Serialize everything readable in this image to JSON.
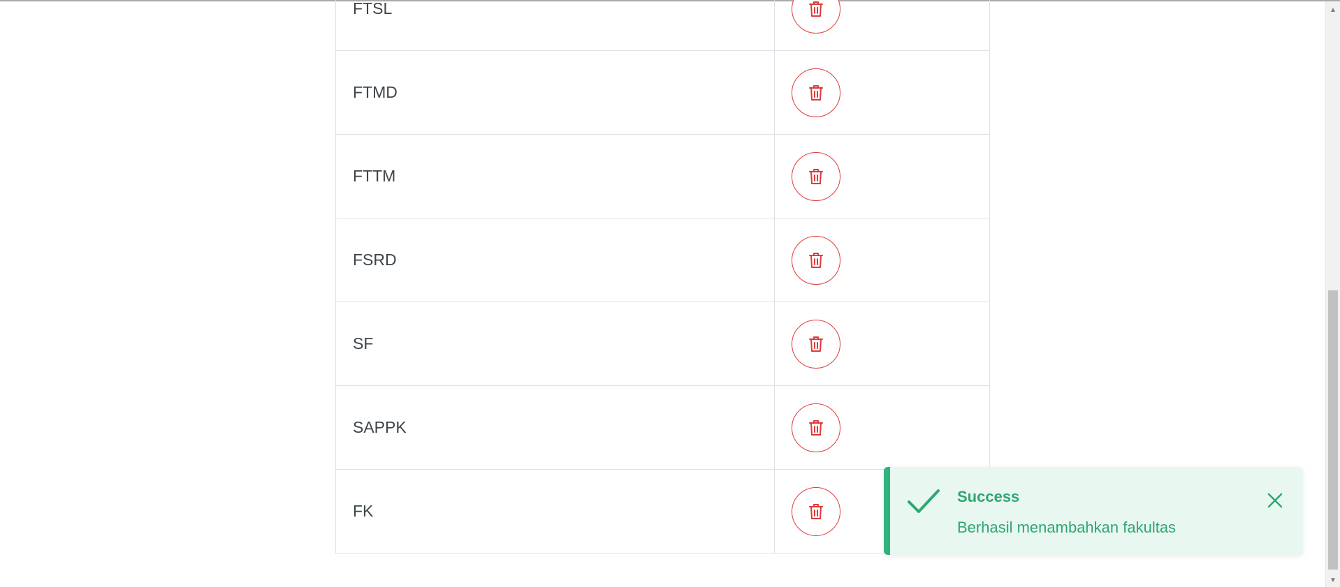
{
  "faculties": [
    {
      "name": "FTSL",
      "action": "delete"
    },
    {
      "name": "FTMD",
      "action": "delete"
    },
    {
      "name": "FTTM",
      "action": "delete"
    },
    {
      "name": "FSRD",
      "action": "delete"
    },
    {
      "name": "SF",
      "action": "delete"
    },
    {
      "name": "SAPPK",
      "action": "delete"
    },
    {
      "name": "FK",
      "action": "delete"
    }
  ],
  "toast": {
    "title": "Success",
    "message": "Berhasil menambahkan fakultas",
    "icon": "check-icon",
    "close_icon": "close-icon",
    "color": "#2fa673",
    "background": "#e8f7ef"
  },
  "colors": {
    "delete_accent": "#e03a3a",
    "text": "#3d4449",
    "border": "#dee2e6"
  },
  "icons": {
    "delete": "trash-icon"
  }
}
